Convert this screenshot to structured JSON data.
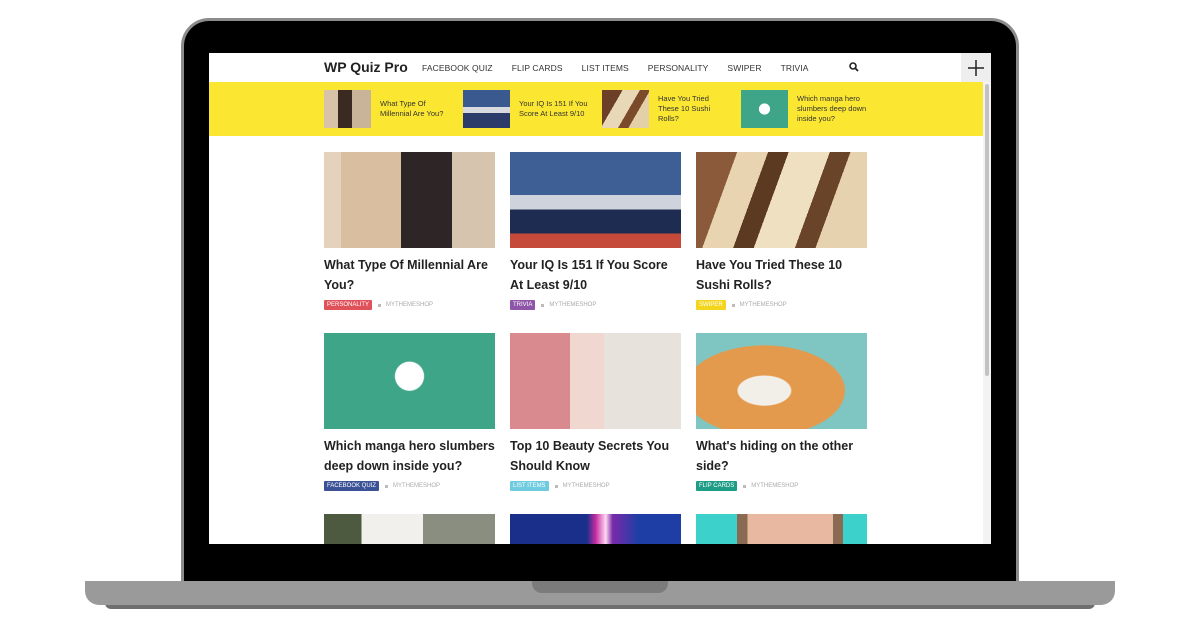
{
  "site": {
    "logo": "WP Quiz Pro",
    "nav": [
      "FACEBOOK QUIZ",
      "FLIP CARDS",
      "LIST ITEMS",
      "PERSONALITY",
      "SWIPER",
      "TRIVIA"
    ],
    "search_icon": "search-icon",
    "plus_icon": "plus-icon"
  },
  "ticker": [
    {
      "title": "What Type Of Millennial Are You?",
      "thumb": "woman-cafe"
    },
    {
      "title": "Your IQ Is 151 If You Score At Least 9/10",
      "thumb": "chess"
    },
    {
      "title": "Have You Tried These 10 Sushi Rolls?",
      "thumb": "sushi"
    },
    {
      "title": "Which manga hero slumbers deep down inside you?",
      "thumb": "manga"
    }
  ],
  "colors": {
    "ticker_bg": "#fbe731",
    "personality": "#e0525a",
    "trivia": "#8e55a8",
    "swiper": "#f2d51c",
    "facebook_quiz": "#3c5296",
    "list_items": "#6fcbe0",
    "flip_cards": "#1f9c86"
  },
  "cards": [
    {
      "title": "What Type Of Millennial Are You?",
      "category": "PERSONALITY",
      "author": "MYTHEMESHOP",
      "thumb": "woman-cafe"
    },
    {
      "title": "Your IQ Is 151 If You Score At Least 9/10",
      "category": "TRIVIA",
      "author": "MYTHEMESHOP",
      "thumb": "chess"
    },
    {
      "title": "Have You Tried These 10 Sushi Rolls?",
      "category": "SWIPER",
      "author": "MYTHEMESHOP",
      "thumb": "sushi"
    },
    {
      "title": "Which manga hero slumbers deep down inside you?",
      "category": "FACEBOOK QUIZ",
      "author": "MYTHEMESHOP",
      "thumb": "manga"
    },
    {
      "title": "Top 10 Beauty Secrets You Should Know",
      "category": "LIST ITEMS",
      "author": "MYTHEMESHOP",
      "thumb": "blonde-woman"
    },
    {
      "title": "What's hiding on the other side?",
      "category": "FLIP CARDS",
      "author": "MYTHEMESHOP",
      "thumb": "cat"
    }
  ]
}
